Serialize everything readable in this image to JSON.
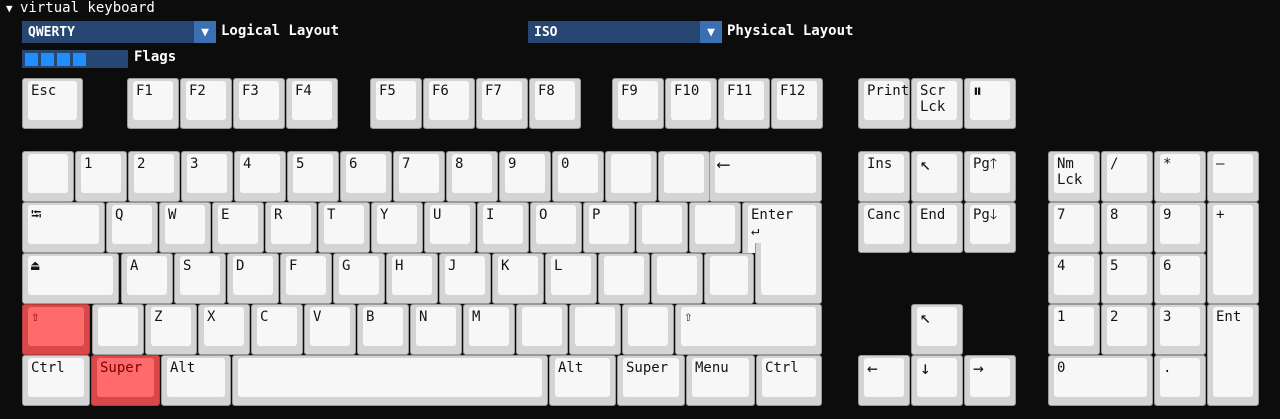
{
  "section_header": "virtual keyboard",
  "logical_layout": {
    "value": "QWERTY",
    "label": "Logical Layout"
  },
  "physical_layout": {
    "value": "ISO",
    "label": "Physical Layout"
  },
  "flags": {
    "label": "Flags",
    "count": 4
  },
  "colors": {
    "pressed": "#ff6b6b",
    "combo": "#274672",
    "flag": "#1f8fff"
  },
  "keys": {
    "esc": "Esc",
    "f1": "F1",
    "f2": "F2",
    "f3": "F3",
    "f4": "F4",
    "f5": "F5",
    "f6": "F6",
    "f7": "F7",
    "f8": "F8",
    "f9": "F9",
    "f10": "F10",
    "f11": "F11",
    "f12": "F12",
    "print": "Print",
    "scrlck": "Scr\nLck",
    "pause": "⏸",
    "grave": "",
    "n1": "1",
    "n2": "2",
    "n3": "3",
    "n4": "4",
    "n5": "5",
    "n6": "6",
    "n7": "7",
    "n8": "8",
    "n9": "9",
    "n0": "0",
    "minus": "",
    "equal": "",
    "backspace": "⟵",
    "tab": "⭾",
    "q": "Q",
    "w": "W",
    "e": "E",
    "r": "R",
    "t": "T",
    "y": "Y",
    "u": "U",
    "i": "I",
    "o": "O",
    "p": "P",
    "lbracket": "",
    "rbracket": "",
    "enter": "Enter\n↵",
    "caps": "⏏",
    "a": "A",
    "s": "S",
    "d": "D",
    "f": "F",
    "g": "G",
    "h": "H",
    "j": "J",
    "k": "K",
    "l": "L",
    "semicolon": "",
    "quote": "",
    "hash": "",
    "lshift": "⇧",
    "iso": "",
    "z": "Z",
    "x": "X",
    "c": "C",
    "v": "V",
    "b": "B",
    "n": "N",
    "m": "M",
    "comma": "",
    "period": "",
    "slash": "",
    "rshift": "⇧",
    "lctrl": "Ctrl",
    "super": "Super",
    "alt": "Alt",
    "space": "",
    "altgr": "Alt",
    "rsuper": "Super",
    "menu": "Menu",
    "rctrl": "Ctrl",
    "ins": "Ins",
    "home": "↖",
    "pgup": "Pg🡑",
    "canc": "Canc",
    "end": "End",
    "pgdn": "Pg🡓",
    "up": "↖",
    "left": "←",
    "down": "↓",
    "right": "→",
    "numlck": "Nm\nLck",
    "kpdiv": "/",
    "kpmul": "*",
    "kpsub": "—",
    "kp7": "7",
    "kp8": "8",
    "kp9": "9",
    "kpadd": "+",
    "kp4": "4",
    "kp5": "5",
    "kp6": "6",
    "kp1": "1",
    "kp2": "2",
    "kp3": "3",
    "kpenter": "Ent",
    "kp0": "0",
    "kpdot": "."
  }
}
